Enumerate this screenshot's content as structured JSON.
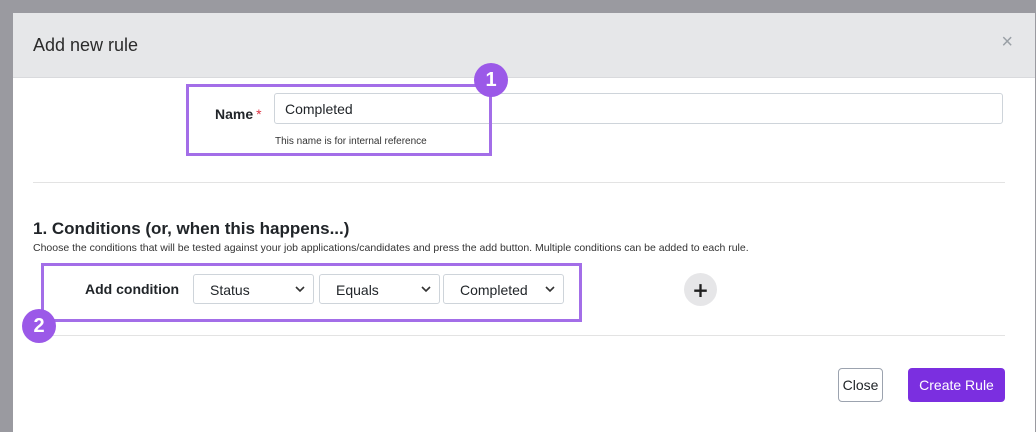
{
  "modal": {
    "title": "Add new rule",
    "close_symbol": "×"
  },
  "name_field": {
    "label": "Name",
    "required_mark": "*",
    "value": "Completed",
    "help": "This name is for internal reference"
  },
  "conditions": {
    "heading": "1. Conditions (or, when this happens...)",
    "description": "Choose the conditions that will be tested against your job applications/candidates and press the add button. Multiple conditions can be added to each rule.",
    "add_label": "Add condition",
    "field_select": "Status",
    "operator_select": "Equals",
    "value_select": "Completed",
    "add_button_symbol": "+"
  },
  "footer": {
    "close_label": "Close",
    "create_label": "Create Rule"
  },
  "annotations": {
    "callout_1": "1",
    "callout_2": "2",
    "color": "#a36ee8"
  },
  "colors": {
    "primary": "#7b2fe0",
    "header_bg": "#e6e7e9",
    "required": "#dc3545"
  },
  "icons": [
    "close-icon",
    "chevron-down-icon",
    "plus-icon"
  ]
}
